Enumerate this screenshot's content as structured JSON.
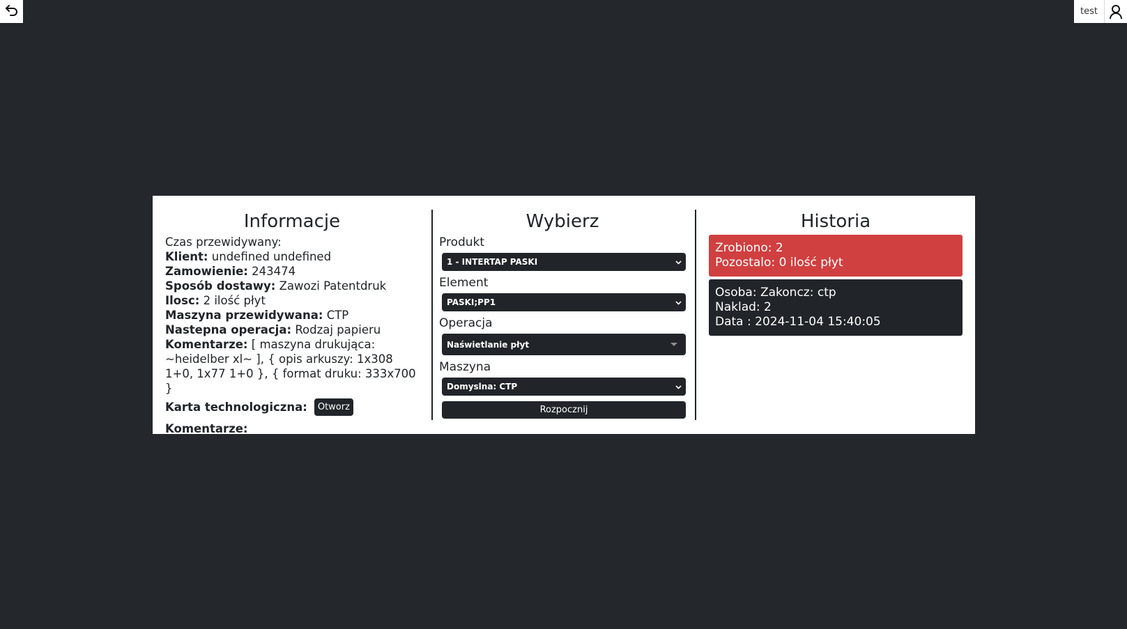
{
  "topbar": {
    "username": "test",
    "back_icon": "undo-arrow-icon",
    "user_icon": "user-icon"
  },
  "info": {
    "title": "Informacje",
    "czas_label": "Czas przewidywany:",
    "klient_label": "Klient:",
    "klient_value": "undefined undefined",
    "zamowienie_label": "Zamowienie:",
    "zamowienie_value": "243474",
    "dostawa_label": "Sposób dostawy:",
    "dostawa_value": "Zawozi Patentdruk",
    "ilosc_label": "Ilosc:",
    "ilosc_value": "2 ilość płyt",
    "maszyna_label": "Maszyna przewidywana:",
    "maszyna_value": "CTP",
    "nastepna_label": "Nastepna operacja:",
    "nastepna_value": "Rodzaj papieru",
    "komentarze_label": "Komentarze:",
    "komentarze_value": "[ maszyna drukująca: ~heidelber xl~ ], { opis arkuszy: 1x308 1+0, 1x77 1+0 }, { format druku: 333x700 }",
    "karta_label": "Karta technologiczna:",
    "karta_button": "Otworz",
    "komentarze2_label": "Komentarze:"
  },
  "select": {
    "title": "Wybierz",
    "produkt_label": "Produkt",
    "produkt_value": "1 - INTERTAP PASKI",
    "element_label": "Element",
    "element_value": "PASKI;PP1",
    "operacja_label": "Operacja",
    "operacja_value": "Naświetlanie płyt",
    "maszyna_label": "Maszyna",
    "maszyna_value": "Domyslna: CTP",
    "start_button": "Rozpocznij"
  },
  "history": {
    "title": "Historia",
    "summary": {
      "zrobiono": "Zrobiono: 2",
      "pozostalo": "Pozostalo: 0 ilość płyt",
      "color": "#d04040"
    },
    "entries": [
      {
        "osoba": "Osoba: Zakoncz: ctp",
        "naklad": "Naklad: 2",
        "data": "Data : 2024-11-04 15:40:05"
      }
    ]
  }
}
